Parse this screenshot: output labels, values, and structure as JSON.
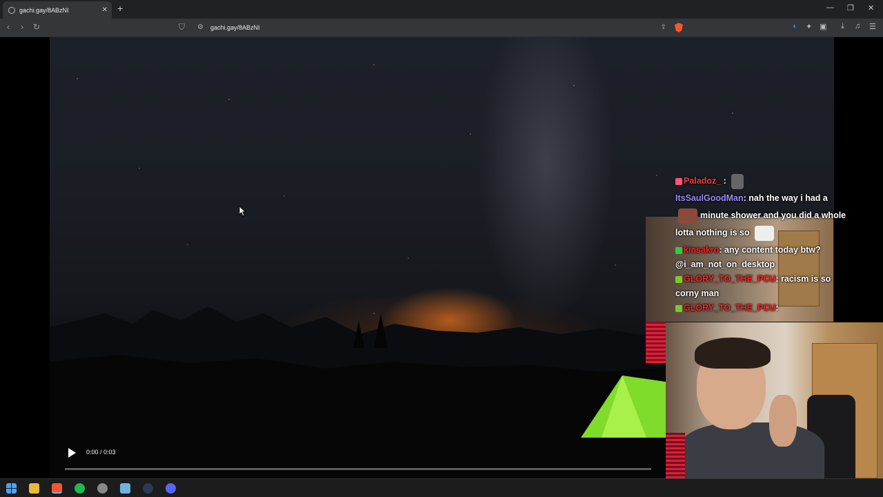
{
  "browser": {
    "tab_title": "gachi.gay/8ABzNI",
    "url": "gachi.gay/8ABzNI",
    "new_tab_label": "+",
    "close_tab_label": "✕"
  },
  "window_controls": {
    "minimize": "—",
    "maximize": "❐",
    "close": "✕"
  },
  "video": {
    "time": "0:00 / 0:03",
    "progress": 0.0
  },
  "chat": {
    "messages": [
      {
        "user": "Paladoz_",
        "user_color": "#ff3a3a",
        "text": ":"
      },
      {
        "user": "ItsSaulGoodMan",
        "user_color": "#9b8cff",
        "text": ": nah the way i had a",
        "text2": "minute shower and you did a whole",
        "text3": "lotta nothing is so"
      },
      {
        "user": "kinsakro",
        "user_color": "#ff2020",
        "text": ": any content today btw?",
        "text2": "@i_am_not_on_desktop"
      },
      {
        "user": "GLORY_TO_THE_PCU",
        "user_color": "#ff2020",
        "text": ": racism is so",
        "text2": "corny man"
      },
      {
        "user": "GLORY_TO_THE_PCU",
        "user_color": "#ff2020",
        "text": ":"
      }
    ]
  },
  "colors": {
    "brave": "#fb542b",
    "accent_blue": "#3a8dde"
  }
}
